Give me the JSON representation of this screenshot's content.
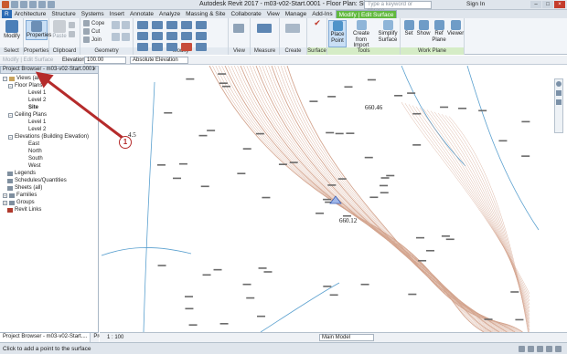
{
  "window": {
    "title": "Autodesk Revit 2017 -  m03-v02-Start.0001 - Floor Plan: Site",
    "search_placeholder": "Type a keyword or phrase",
    "signin": "Sign In",
    "minimize": "–",
    "maximize": "□",
    "close": "×"
  },
  "tabs": [
    {
      "label": "R"
    },
    {
      "label": "Architecture"
    },
    {
      "label": "Structure"
    },
    {
      "label": "Systems"
    },
    {
      "label": "Insert"
    },
    {
      "label": "Annotate"
    },
    {
      "label": "Analyze"
    },
    {
      "label": "Massing & Site"
    },
    {
      "label": "Collaborate"
    },
    {
      "label": "View"
    },
    {
      "label": "Manage"
    },
    {
      "label": "Add-Ins"
    },
    {
      "label": "Modify | Edit Surface"
    }
  ],
  "ribbon": {
    "select_panel": "Select",
    "modify_btn": "Modify",
    "properties_panel": "Properties",
    "properties_btn": "Properties",
    "clipboard_panel": "Clipboard",
    "paste_btn": "Paste",
    "cope_label": "Cope",
    "cut_label": "Cut",
    "join_label": "Join",
    "geometry_panel": "Geometry",
    "modify_panel": "Modify",
    "view_panel": "View",
    "measure_panel": "Measure",
    "create_panel": "Create",
    "surface_panel": "Surface",
    "place_point_btn": "Place Point",
    "create_import_btn": "Create from Import",
    "simplify_btn": "Simplify Surface",
    "tools_panel": "Tools",
    "set_btn": "Set",
    "show_btn": "Show",
    "ref_plane_btn": "Ref Plane",
    "viewer_btn": "Viewer",
    "workplane_panel": "Work Plane"
  },
  "options_bar": {
    "context": "Modify | Edit Surface",
    "elevation_label": "Elevation",
    "elevation_value": "100.00",
    "elevation_mode": "Absolute Elevation"
  },
  "project_browser": {
    "title": "Project Browser - m03-v02-Start.0001",
    "close": "×",
    "tree": [
      {
        "label": "Views (all)",
        "level": 0,
        "toggle": "−"
      },
      {
        "label": "Floor Plans",
        "level": 1,
        "toggle": "−"
      },
      {
        "label": "Level 1",
        "level": 2
      },
      {
        "label": "Level 2",
        "level": 2
      },
      {
        "label": "Site",
        "level": 2,
        "bold": true
      },
      {
        "label": "Ceiling Plans",
        "level": 1,
        "toggle": "−"
      },
      {
        "label": "Level 1",
        "level": 2
      },
      {
        "label": "Level 2",
        "level": 2
      },
      {
        "label": "Elevations (Building Elevation)",
        "level": 1,
        "toggle": "−"
      },
      {
        "label": "East",
        "level": 2
      },
      {
        "label": "North",
        "level": 2
      },
      {
        "label": "South",
        "level": 2
      },
      {
        "label": "West",
        "level": 2
      },
      {
        "label": "Legends",
        "level": 0
      },
      {
        "label": "Schedules/Quantities",
        "level": 0
      },
      {
        "label": "Sheets (all)",
        "level": 0
      },
      {
        "label": "Families",
        "level": 0,
        "toggle": "+"
      },
      {
        "label": "Groups",
        "level": 0,
        "toggle": "+"
      },
      {
        "label": "Revit Links",
        "level": 0
      }
    ],
    "tab_browser": "Project Browser - m03-v02-Start....",
    "tab_properties": "Properties"
  },
  "canvas": {
    "elevation_1": "660.46",
    "elevation_2": "660.12",
    "edge_label": "4.5"
  },
  "view_control": {
    "scale": "1 : 100",
    "model": "Main Model"
  },
  "status": {
    "message": "Click to add a point to the surface"
  },
  "callout": {
    "number": "1",
    "color": "#b52b2b"
  },
  "colors": {
    "contour": "#d4a58f",
    "boundary": "#5aa0cf",
    "file_tab": "#2b6bb5",
    "context_tab": "#61b93f"
  }
}
